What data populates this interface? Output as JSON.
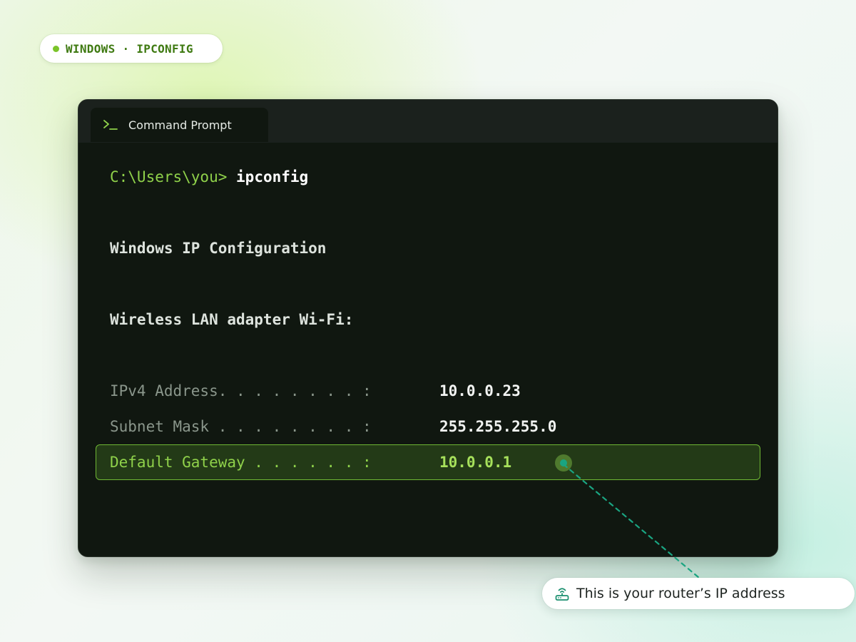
{
  "tag": {
    "text": "WINDOWS · IPCONFIG",
    "dot_color": "#7bc42a"
  },
  "window": {
    "tab": {
      "icon": "terminal-prompt-icon",
      "title": "Command Prompt"
    },
    "terminal": {
      "prompt_path": "C:\\Users\\you>",
      "command": "ipconfig",
      "heading": "Windows IP Configuration",
      "adapter": "Wireless LAN adapter Wi-Fi:",
      "rows": [
        {
          "label": "IPv4 Address. . . . . . . . :",
          "value": "10.0.0.23"
        },
        {
          "label": "Subnet Mask . . . . . . . . :",
          "value": "255.255.255.0"
        },
        {
          "label": "Default Gateway . . . . . . :",
          "value": "10.0.0.1",
          "highlighted": true
        }
      ]
    }
  },
  "callout": {
    "icon": "router-icon",
    "text": "This is your router’s IP address"
  },
  "colors": {
    "accent": "#8fd14a",
    "highlight_border": "#6fb834",
    "connector": "#1aa582",
    "terminal_bg": "#101710"
  }
}
